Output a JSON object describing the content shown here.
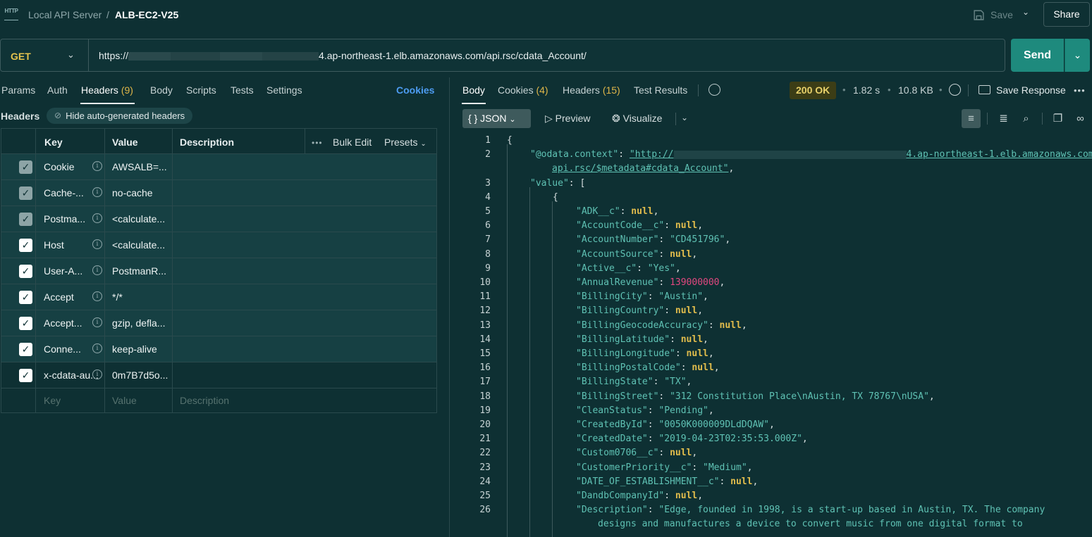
{
  "breadcrumb": {
    "parent": "Local API Server",
    "separator": "/",
    "current": "ALB-EC2-V25"
  },
  "toolbar": {
    "save_label": "Save",
    "share_label": "Share"
  },
  "request": {
    "method": "GET",
    "url_prefix": "https://",
    "url_suffix": "4.ap-northeast-1.elb.amazonaws.com/api.rsc/cdata_Account/",
    "send_label": "Send"
  },
  "left_tabs": [
    {
      "label": "Params"
    },
    {
      "label": "Auth"
    },
    {
      "label": "Headers",
      "count": "(9)"
    },
    {
      "label": "Body"
    },
    {
      "label": "Scripts"
    },
    {
      "label": "Tests"
    },
    {
      "label": "Settings"
    }
  ],
  "cookies_link": "Cookies",
  "headers_section": {
    "title": "Headers",
    "hide_toggle": "Hide auto-generated headers",
    "columns": {
      "key": "Key",
      "value": "Value",
      "description": "Description"
    },
    "bulk_edit": "Bulk Edit",
    "presets": "Presets",
    "rows": [
      {
        "key": "Cookie",
        "value": "AWSALB=...",
        "checked": true,
        "auto": true
      },
      {
        "key": "Cache-...",
        "value": "no-cache",
        "checked": true,
        "auto": true
      },
      {
        "key": "Postma...",
        "value": "<calculate...",
        "checked": true,
        "auto": true
      },
      {
        "key": "Host",
        "value": "<calculate...",
        "checked": true,
        "auto": false
      },
      {
        "key": "User-A...",
        "value": "PostmanR...",
        "checked": true,
        "auto": false
      },
      {
        "key": "Accept",
        "value": "*/*",
        "checked": true,
        "auto": false
      },
      {
        "key": "Accept...",
        "value": "gzip, defla...",
        "checked": true,
        "auto": false
      },
      {
        "key": "Conne...",
        "value": "keep-alive",
        "checked": true,
        "auto": false
      },
      {
        "key": "x-cdata-au...",
        "value": "0m7B7d5o...",
        "checked": true,
        "auto": false
      }
    ],
    "empty_row": {
      "key": "Key",
      "value": "Value",
      "description": "Description"
    }
  },
  "response_tabs": [
    {
      "label": "Body"
    },
    {
      "label": "Cookies",
      "count": "(4)"
    },
    {
      "label": "Headers",
      "count": "(15)"
    },
    {
      "label": "Test Results"
    }
  ],
  "response_meta": {
    "status": "200 OK",
    "time": "1.82 s",
    "size": "10.8 KB",
    "save_response": "Save Response"
  },
  "body_toolbar": {
    "format": "JSON",
    "preview": "Preview",
    "visualize": "Visualize"
  },
  "colors": {
    "background": "#0e3033",
    "accent_send": "#1e8a7d",
    "status_badge": "#3c3d16",
    "count": "#dfb649",
    "link": "#4d9cf2"
  },
  "icons": [
    "http-icon",
    "save-icon",
    "chevron-down-icon",
    "info-icon",
    "checkbox-icon",
    "eye-slash-icon",
    "history-icon",
    "globe-icon",
    "wrap-icon",
    "filter-icon",
    "search-icon",
    "copy-icon",
    "link-icon",
    "play-icon",
    "visualize-icon",
    "more-icon"
  ],
  "code_lines": [
    {
      "n": "1",
      "parts": [
        [
          "p",
          "{"
        ]
      ]
    },
    {
      "n": "2",
      "parts": [
        [
          "k",
          "\"@odata.context\""
        ],
        [
          "p",
          ": "
        ],
        [
          "u",
          "\"http://"
        ],
        [
          "r",
          ""
        ],
        [
          "u",
          "4.ap-northeast-1.elb.amazonaws.com/"
        ]
      ]
    },
    {
      "n": "",
      "parts": [
        [
          "u",
          "api.rsc/$metadata#cdata_Account\""
        ],
        [
          "p",
          ","
        ]
      ]
    },
    {
      "n": "3",
      "parts": [
        [
          "k",
          "\"value\""
        ],
        [
          "p",
          ": ["
        ]
      ]
    },
    {
      "n": "4",
      "parts": [
        [
          "p",
          "{"
        ]
      ]
    },
    {
      "n": "5",
      "parts": [
        [
          "k",
          "\"ADK__c\""
        ],
        [
          "p",
          ": "
        ],
        [
          "n",
          "null"
        ],
        [
          "p",
          ","
        ]
      ]
    },
    {
      "n": "6",
      "parts": [
        [
          "k",
          "\"AccountCode__c\""
        ],
        [
          "p",
          ": "
        ],
        [
          "n",
          "null"
        ],
        [
          "p",
          ","
        ]
      ]
    },
    {
      "n": "7",
      "parts": [
        [
          "k",
          "\"AccountNumber\""
        ],
        [
          "p",
          ": "
        ],
        [
          "s",
          "\"CD451796\""
        ],
        [
          "p",
          ","
        ]
      ]
    },
    {
      "n": "8",
      "parts": [
        [
          "k",
          "\"AccountSource\""
        ],
        [
          "p",
          ": "
        ],
        [
          "n",
          "null"
        ],
        [
          "p",
          ","
        ]
      ]
    },
    {
      "n": "9",
      "parts": [
        [
          "k",
          "\"Active__c\""
        ],
        [
          "p",
          ": "
        ],
        [
          "s",
          "\"Yes\""
        ],
        [
          "p",
          ","
        ]
      ]
    },
    {
      "n": "10",
      "parts": [
        [
          "k",
          "\"AnnualRevenue\""
        ],
        [
          "p",
          ": "
        ],
        [
          "num",
          "139000000"
        ],
        [
          "p",
          ","
        ]
      ]
    },
    {
      "n": "11",
      "parts": [
        [
          "k",
          "\"BillingCity\""
        ],
        [
          "p",
          ": "
        ],
        [
          "s",
          "\"Austin\""
        ],
        [
          "p",
          ","
        ]
      ]
    },
    {
      "n": "12",
      "parts": [
        [
          "k",
          "\"BillingCountry\""
        ],
        [
          "p",
          ": "
        ],
        [
          "n",
          "null"
        ],
        [
          "p",
          ","
        ]
      ]
    },
    {
      "n": "13",
      "parts": [
        [
          "k",
          "\"BillingGeocodeAccuracy\""
        ],
        [
          "p",
          ": "
        ],
        [
          "n",
          "null"
        ],
        [
          "p",
          ","
        ]
      ]
    },
    {
      "n": "14",
      "parts": [
        [
          "k",
          "\"BillingLatitude\""
        ],
        [
          "p",
          ": "
        ],
        [
          "n",
          "null"
        ],
        [
          "p",
          ","
        ]
      ]
    },
    {
      "n": "15",
      "parts": [
        [
          "k",
          "\"BillingLongitude\""
        ],
        [
          "p",
          ": "
        ],
        [
          "n",
          "null"
        ],
        [
          "p",
          ","
        ]
      ]
    },
    {
      "n": "16",
      "parts": [
        [
          "k",
          "\"BillingPostalCode\""
        ],
        [
          "p",
          ": "
        ],
        [
          "n",
          "null"
        ],
        [
          "p",
          ","
        ]
      ]
    },
    {
      "n": "17",
      "parts": [
        [
          "k",
          "\"BillingState\""
        ],
        [
          "p",
          ": "
        ],
        [
          "s",
          "\"TX\""
        ],
        [
          "p",
          ","
        ]
      ]
    },
    {
      "n": "18",
      "parts": [
        [
          "k",
          "\"BillingStreet\""
        ],
        [
          "p",
          ": "
        ],
        [
          "s",
          "\"312 Constitution Place\\nAustin, TX 78767\\nUSA\""
        ],
        [
          "p",
          ","
        ]
      ]
    },
    {
      "n": "19",
      "parts": [
        [
          "k",
          "\"CleanStatus\""
        ],
        [
          "p",
          ": "
        ],
        [
          "s",
          "\"Pending\""
        ],
        [
          "p",
          ","
        ]
      ]
    },
    {
      "n": "20",
      "parts": [
        [
          "k",
          "\"CreatedById\""
        ],
        [
          "p",
          ": "
        ],
        [
          "s",
          "\"0050K000009DLdDQAW\""
        ],
        [
          "p",
          ","
        ]
      ]
    },
    {
      "n": "21",
      "parts": [
        [
          "k",
          "\"CreatedDate\""
        ],
        [
          "p",
          ": "
        ],
        [
          "s",
          "\"2019-04-23T02:35:53.000Z\""
        ],
        [
          "p",
          ","
        ]
      ]
    },
    {
      "n": "22",
      "parts": [
        [
          "k",
          "\"Custom0706__c\""
        ],
        [
          "p",
          ": "
        ],
        [
          "n",
          "null"
        ],
        [
          "p",
          ","
        ]
      ]
    },
    {
      "n": "23",
      "parts": [
        [
          "k",
          "\"CustomerPriority__c\""
        ],
        [
          "p",
          ": "
        ],
        [
          "s",
          "\"Medium\""
        ],
        [
          "p",
          ","
        ]
      ]
    },
    {
      "n": "24",
      "parts": [
        [
          "k",
          "\"DATE_OF_ESTABLISHMENT__c\""
        ],
        [
          "p",
          ": "
        ],
        [
          "n",
          "null"
        ],
        [
          "p",
          ","
        ]
      ]
    },
    {
      "n": "25",
      "parts": [
        [
          "k",
          "\"DandbCompanyId\""
        ],
        [
          "p",
          ": "
        ],
        [
          "n",
          "null"
        ],
        [
          "p",
          ","
        ]
      ]
    },
    {
      "n": "26",
      "parts": [
        [
          "k",
          "\"Description\""
        ],
        [
          "p",
          ": "
        ],
        [
          "s",
          "\"Edge, founded in 1998, is a start-up based in Austin, TX. The company"
        ]
      ]
    },
    {
      "n": "",
      "parts": [
        [
          "s",
          "designs and manufactures a device to convert music from one digital format to"
        ]
      ]
    }
  ]
}
